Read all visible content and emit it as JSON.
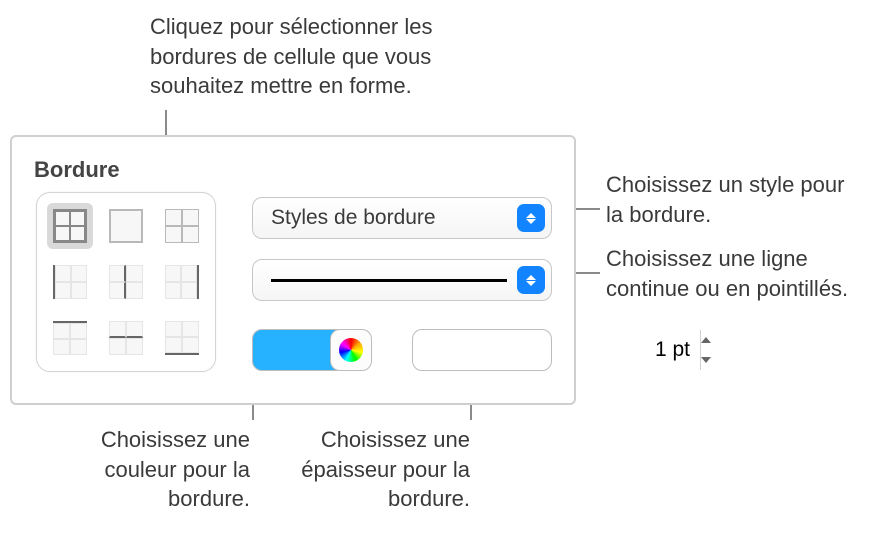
{
  "panel": {
    "title": "Bordure",
    "styles_label": "Styles de bordure",
    "thickness_value": "1 pt",
    "swatch_color": "#26b2ff"
  },
  "border_picker": {
    "cells": [
      "all",
      "outer",
      "inner",
      "left",
      "midv",
      "right",
      "top",
      "midh",
      "bottom"
    ],
    "selected_index": 0
  },
  "callouts": {
    "top": "Cliquez pour sélectionner les bordures de cellule que vous souhaitez mettre en forme.",
    "style": "Choisissez un style pour la bordure.",
    "line": "Choisissez une ligne continue ou en pointillés.",
    "color": "Choisissez une couleur pour la bordure.",
    "thickness": "Choisissez une épaisseur pour la bordure."
  }
}
